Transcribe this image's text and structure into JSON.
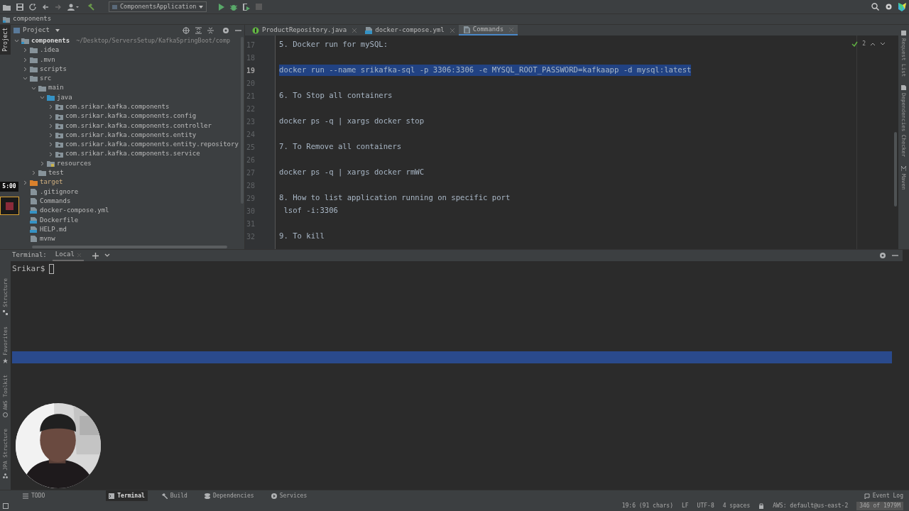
{
  "toolbar": {
    "run_configuration": "ComponentsApplication"
  },
  "breadcrumb": "components",
  "left_strip": [
    {
      "label": "Project",
      "selected": true
    }
  ],
  "recorder": {
    "timer": "5:00"
  },
  "project_panel": {
    "title": "Project",
    "tree": [
      {
        "label": "components",
        "path": "~/Desktop/ServersSetup/KafkaSpringBoot/comp",
        "kind": "module",
        "expanded": true,
        "children": [
          {
            "label": ".idea",
            "kind": "folder",
            "expanded": false
          },
          {
            "label": ".mvn",
            "kind": "folder",
            "expanded": false
          },
          {
            "label": "scripts",
            "kind": "folder",
            "expanded": false
          },
          {
            "label": "src",
            "kind": "folder",
            "expanded": true,
            "children": [
              {
                "label": "main",
                "kind": "folder",
                "expanded": true,
                "children": [
                  {
                    "label": "java",
                    "kind": "source",
                    "expanded": true,
                    "children": [
                      {
                        "label": "com.srikar.kafka.components",
                        "kind": "package",
                        "expanded": false
                      },
                      {
                        "label": "com.srikar.kafka.components.config",
                        "kind": "package",
                        "expanded": false
                      },
                      {
                        "label": "com.srikar.kafka.components.controller",
                        "kind": "package",
                        "expanded": false
                      },
                      {
                        "label": "com.srikar.kafka.components.entity",
                        "kind": "package",
                        "expanded": false
                      },
                      {
                        "label": "com.srikar.kafka.components.entity.repository",
                        "kind": "package",
                        "expanded": false
                      },
                      {
                        "label": "com.srikar.kafka.components.service",
                        "kind": "package",
                        "expanded": false
                      }
                    ]
                  },
                  {
                    "label": "resources",
                    "kind": "resources",
                    "expanded": false
                  }
                ]
              },
              {
                "label": "test",
                "kind": "folder",
                "expanded": false
              }
            ]
          },
          {
            "label": "target",
            "kind": "excluded",
            "expanded": false
          },
          {
            "label": ".gitignore",
            "kind": "file"
          },
          {
            "label": "Commands",
            "kind": "file"
          },
          {
            "label": "docker-compose.yml",
            "kind": "config"
          },
          {
            "label": "Dockerfile",
            "kind": "config"
          },
          {
            "label": "HELP.md",
            "kind": "config"
          },
          {
            "label": "mvnw",
            "kind": "file"
          }
        ]
      }
    ]
  },
  "editor": {
    "tabs": [
      {
        "label": "ProductRepository.java",
        "kind": "java",
        "selected": false
      },
      {
        "label": "docker-compose.yml",
        "kind": "yml",
        "selected": false
      },
      {
        "label": "Commands",
        "kind": "text",
        "selected": true
      }
    ],
    "inspection_count": "2",
    "lines": [
      {
        "number": "17",
        "text": "5. Docker run for mySQL:",
        "selected": false
      },
      {
        "number": "18",
        "selected": false
      },
      {
        "number": "19",
        "text": "docker run --name srikafka-sql -p 3306:3306 -e MYSQL_ROOT_PASSWORD=kafkaapp -d mysql:latest",
        "selected": true
      },
      {
        "number": "20",
        "selected": false
      },
      {
        "number": "21",
        "text": "6. To Stop all containers",
        "selected": false
      },
      {
        "number": "22",
        "selected": false
      },
      {
        "number": "23",
        "text": "docker ps -q | xargs docker stop",
        "selected": false
      },
      {
        "number": "24",
        "selected": false
      },
      {
        "number": "25",
        "text": "7. To Remove all containers",
        "selected": false
      },
      {
        "number": "26",
        "selected": false
      },
      {
        "number": "27",
        "text": "docker ps -q | xargs docker rmWC",
        "selected": false
      },
      {
        "number": "28",
        "selected": false
      },
      {
        "number": "29",
        "text": "8. How to list application running on specific port",
        "selected": false
      },
      {
        "number": "30",
        "text": " lsof -i:3306",
        "selected": false
      },
      {
        "number": "31",
        "selected": false
      },
      {
        "number": "32",
        "text": "9. To kill",
        "selected": false
      }
    ]
  },
  "right_strip": [
    {
      "label": "Request List"
    },
    {
      "label": "Dependencies Checker"
    },
    {
      "label": "Maven"
    }
  ],
  "terminal": {
    "title": "Terminal:",
    "tabs": [
      {
        "label": "Local",
        "selected": true
      }
    ],
    "prompt": "Srikar$"
  },
  "side_tools": [
    {
      "label": "Structure",
      "kind": "structure"
    },
    {
      "label": "Favorites",
      "kind": "star"
    },
    {
      "label": "AWS Toolkit",
      "kind": "aws"
    },
    {
      "label": "JPA Structure",
      "kind": "jpa"
    }
  ],
  "tool_windows": [
    {
      "label": "TODO",
      "kind": "list",
      "selected": false
    },
    {
      "label": "Terminal",
      "kind": "terminal",
      "selected": true
    },
    {
      "label": "Build",
      "kind": "hammer",
      "selected": false
    },
    {
      "label": "Dependencies",
      "kind": "deps",
      "selected": false
    },
    {
      "label": "Services",
      "kind": "services",
      "selected": false
    }
  ],
  "event_log": "Event Log",
  "status_bar": [
    {
      "text": "19:6 (91 chars)"
    },
    {
      "text": "LF"
    },
    {
      "text": "UTF-8"
    },
    {
      "text": "4 spaces"
    },
    {
      "text": "AWS: default@us-east-2"
    }
  ],
  "memory": "346 of 1979M"
}
